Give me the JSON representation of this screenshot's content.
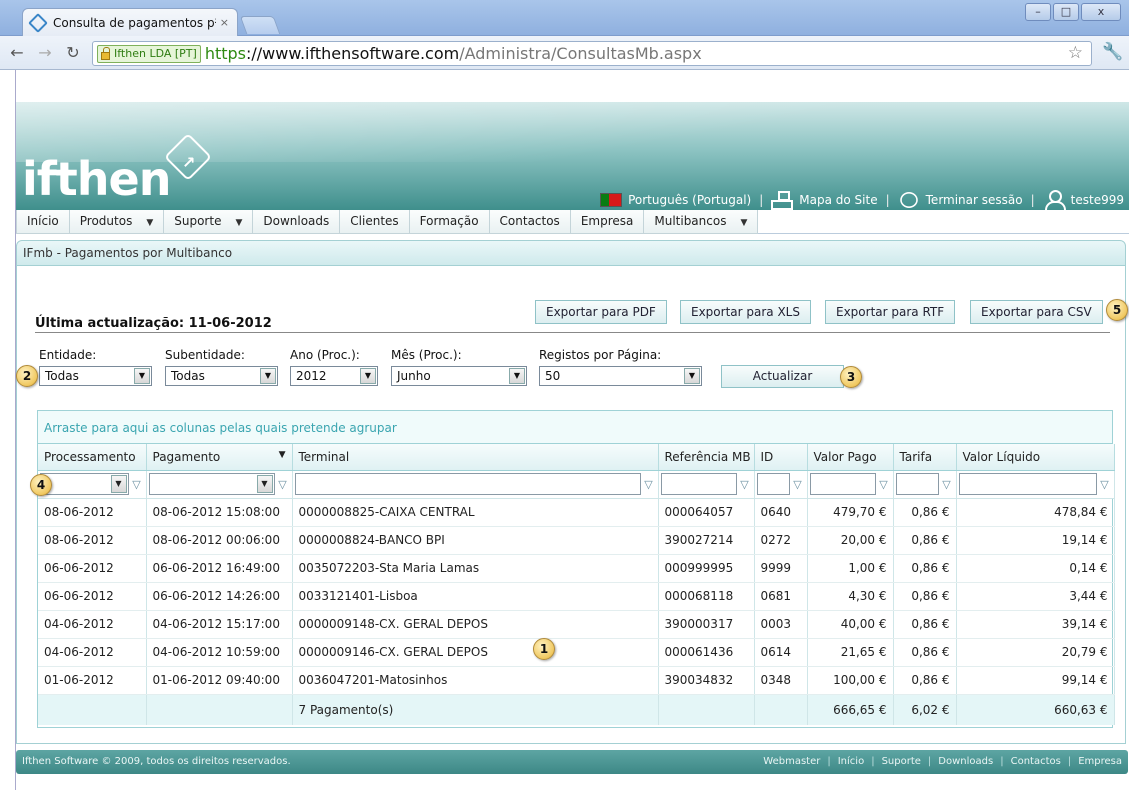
{
  "browser": {
    "tab_title": "Consulta de pagamentos p²",
    "tab_close": "×",
    "win_min": "–",
    "win_max": "□",
    "win_close": "x",
    "security_label": "Ifthen LDA [PT]",
    "url_scheme": "https",
    "url_host": "://www.ifthensoftware.com",
    "url_path": "/Administra/ConsultasMb.aspx"
  },
  "header": {
    "logo_text": "ifthen",
    "language": "Português (Portugal)",
    "sitemap": "Mapa do Site",
    "logout": "Terminar sessão",
    "user": "teste999"
  },
  "menu": [
    {
      "label": "Início",
      "dropdown": false
    },
    {
      "label": "Produtos",
      "dropdown": true
    },
    {
      "label": "Suporte",
      "dropdown": true
    },
    {
      "label": "Downloads",
      "dropdown": false
    },
    {
      "label": "Clientes",
      "dropdown": false
    },
    {
      "label": "Formação",
      "dropdown": false
    },
    {
      "label": "Contactos",
      "dropdown": false
    },
    {
      "label": "Empresa",
      "dropdown": false
    },
    {
      "label": "Multibancos",
      "dropdown": true
    }
  ],
  "breadcrumb": "IFmb - Pagamentos por Multibanco",
  "last_update": "Última actualização: 11-06-2012",
  "exports": {
    "pdf": "Exportar para PDF",
    "xls": "Exportar para XLS",
    "rtf": "Exportar para RTF",
    "csv": "Exportar para CSV"
  },
  "filters": {
    "entidade": {
      "label": "Entidade:",
      "value": "Todas"
    },
    "subentidade": {
      "label": "Subentidade:",
      "value": "Todas"
    },
    "ano": {
      "label": "Ano (Proc.):",
      "value": "2012"
    },
    "mes": {
      "label": "Mês (Proc.):",
      "value": "Junho"
    },
    "registos": {
      "label": "Registos por Página:",
      "value": "50"
    },
    "update_button": "Actualizar"
  },
  "badges": {
    "b1": "1",
    "b2": "2",
    "b3": "3",
    "b4": "4",
    "b5": "5"
  },
  "grid": {
    "group_hint": "Arraste para aqui as colunas pelas quais pretende agrupar",
    "columns": [
      "Processamento",
      "Pagamento",
      "Terminal",
      "Referência MB",
      "ID",
      "Valor Pago",
      "Tarifa",
      "Valor Líquido"
    ],
    "rows": [
      [
        "08-06-2012",
        "08-06-2012 15:08:00",
        "0000008825-CAIXA CENTRAL",
        "000064057",
        "0640",
        "479,70 €",
        "0,86 €",
        "478,84 €"
      ],
      [
        "08-06-2012",
        "08-06-2012 00:06:00",
        "0000008824-BANCO BPI",
        "390027214",
        "0272",
        "20,00 €",
        "0,86 €",
        "19,14 €"
      ],
      [
        "06-06-2012",
        "06-06-2012 16:49:00",
        "0035072203-Sta Maria Lamas",
        "000999995",
        "9999",
        "1,00 €",
        "0,86 €",
        "0,14 €"
      ],
      [
        "06-06-2012",
        "06-06-2012 14:26:00",
        "0033121401-Lisboa",
        "000068118",
        "0681",
        "4,30 €",
        "0,86 €",
        "3,44 €"
      ],
      [
        "04-06-2012",
        "04-06-2012 15:17:00",
        "0000009148-CX. GERAL DEPOS",
        "390000317",
        "0003",
        "40,00 €",
        "0,86 €",
        "39,14 €"
      ],
      [
        "04-06-2012",
        "04-06-2012 10:59:00",
        "0000009146-CX. GERAL DEPOS",
        "000061436",
        "0614",
        "21,65 €",
        "0,86 €",
        "20,79 €"
      ],
      [
        "01-06-2012",
        "01-06-2012 09:40:00",
        "0036047201-Matosinhos",
        "390034832",
        "0348",
        "100,00 €",
        "0,86 €",
        "99,14 €"
      ]
    ],
    "footer": {
      "count": "7 Pagamento(s)",
      "valor_pago": "666,65 €",
      "tarifa": "6,02 €",
      "valor_liquido": "660,63 €"
    }
  },
  "site_footer": {
    "copyright": "Ifthen Software © 2009, todos os direitos reservados.",
    "links": [
      "Webmaster",
      "Início",
      "Suporte",
      "Downloads",
      "Contactos",
      "Empresa"
    ]
  },
  "colors": {
    "accent": "#3d8886",
    "grid_border": "#9fd2d6",
    "link": "#3aa5b0"
  }
}
